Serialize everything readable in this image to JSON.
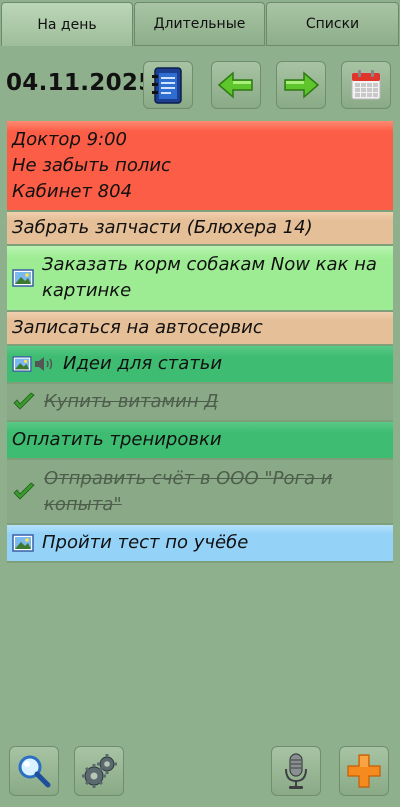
{
  "tabs": [
    {
      "label": "На день",
      "active": true
    },
    {
      "label": "Длительные",
      "active": false
    },
    {
      "label": "Списки",
      "active": false
    }
  ],
  "toolbar": {
    "date": "04.11.2025",
    "icons": [
      "notes-icon",
      "arrow-left-icon",
      "arrow-right-icon",
      "calendar-icon"
    ]
  },
  "tasks": [
    {
      "text_lines": [
        "Доктор 9:00",
        "Не забыть полис",
        "Кабинет 804"
      ],
      "color": "#fc5d46",
      "done": false,
      "icons": []
    },
    {
      "text": "Забрать запчасти (Блюхера 14)",
      "color": "#e5bf97",
      "done": false,
      "icons": []
    },
    {
      "text": "Заказать корм собакам Now как на картинке",
      "color": "#9dec93",
      "done": false,
      "icons": [
        "image-icon"
      ]
    },
    {
      "text": "Записаться на автосервис",
      "color": "#e5bf97",
      "done": false,
      "icons": []
    },
    {
      "text": "Идеи для статьи",
      "color": "#3ebc72",
      "done": false,
      "icons": [
        "image-icon",
        "audio-icon"
      ]
    },
    {
      "text": "Купить витамин Д",
      "color": "#8aaa87",
      "done": true,
      "icons": [
        "check-icon"
      ]
    },
    {
      "text": "Оплатить тренировки",
      "color": "#3ebc72",
      "done": false,
      "icons": []
    },
    {
      "text": "Отправить счёт в ООО \"Рога и копыта\"",
      "color": "#8aaa87",
      "done": true,
      "icons": [
        "check-icon"
      ]
    },
    {
      "text": "Пройти тест по учёбе",
      "color": "#95d2f8",
      "done": false,
      "icons": [
        "image-icon"
      ]
    }
  ],
  "bottom_bar": {
    "icons": [
      "search-icon",
      "settings-icon",
      "microphone-icon",
      "add-icon"
    ],
    "accent_add": "#f58a1f"
  }
}
